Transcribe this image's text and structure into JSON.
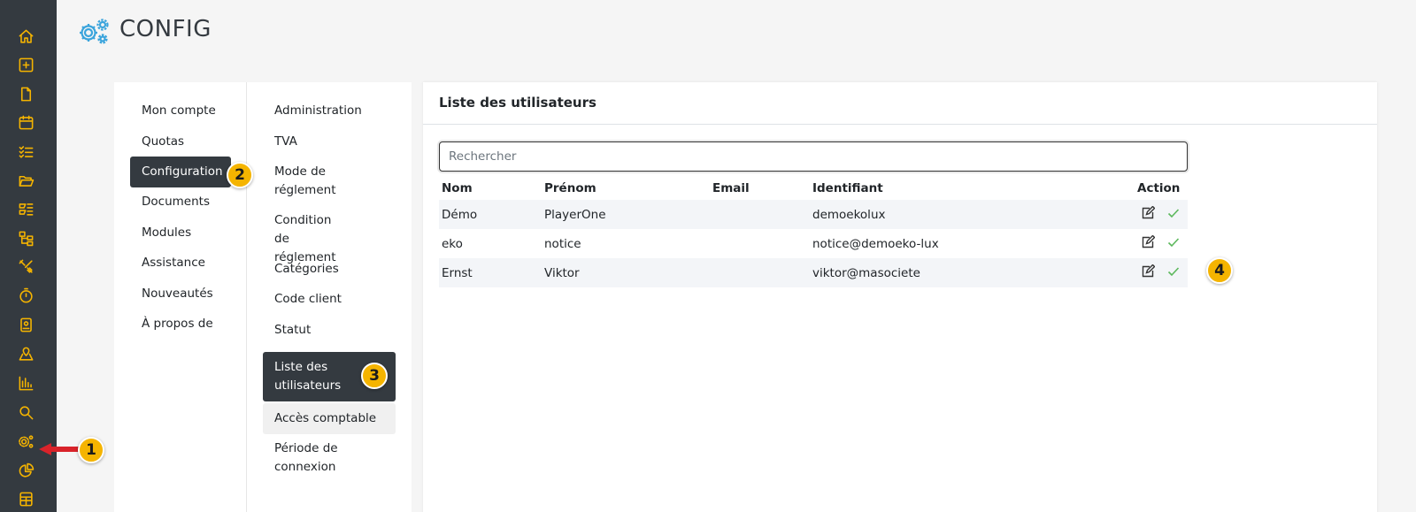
{
  "header": {
    "title": "CONFIG",
    "icon": "gears-icon",
    "icon_color": "#3aa4dc"
  },
  "rail": {
    "background": "#343a40",
    "icon_color": "#f5b400",
    "icons": [
      "home-icon",
      "plus-square-icon",
      "file-icon",
      "calendar-icon",
      "checklist-icon",
      "folder-open-icon",
      "tools-list-icon",
      "sitemap-icon",
      "wrench-screwdriver-icon",
      "stopwatch-icon",
      "contact-card-icon",
      "map-pin-icon",
      "bar-chart-icon",
      "search-icon",
      "gears-icon",
      "pie-chart-icon",
      "calculator-icon"
    ]
  },
  "menu": {
    "primary": [
      {
        "label": "Mon compte"
      },
      {
        "label": "Quotas"
      },
      {
        "label": "Configuration",
        "active": true
      },
      {
        "label": "Documents"
      },
      {
        "label": "Modules"
      },
      {
        "label": "Assistance"
      },
      {
        "label": "Nouveautés"
      },
      {
        "label": "À propos de"
      }
    ],
    "secondary": [
      {
        "label": "Administration"
      },
      {
        "label": "TVA"
      },
      {
        "label": "Mode de réglement"
      },
      {
        "label": "Condition de réglement"
      },
      {
        "label": "Catégories"
      },
      {
        "label": "Code client"
      },
      {
        "label": "Statut"
      },
      {
        "label": "Liste des utilisateurs",
        "active": true
      },
      {
        "label": "Accès comptable",
        "hover": true
      },
      {
        "label": "Période de connexion"
      }
    ]
  },
  "users": {
    "title": "Liste des utilisateurs",
    "search_placeholder": "Rechercher",
    "columns": [
      "Nom",
      "Prénom",
      "Email",
      "Identifiant",
      "Action"
    ],
    "rows": [
      {
        "nom": "Démo",
        "prenom": "PlayerOne",
        "email": "",
        "identifiant": "demoekolux"
      },
      {
        "nom": "eko",
        "prenom": "notice",
        "email": "",
        "identifiant": "notice@demoeko-lux"
      },
      {
        "nom": "Ernst",
        "prenom": "Viktor",
        "email": "",
        "identifiant": "viktor@masociete"
      }
    ],
    "actions": [
      "edit-icon",
      "check-icon"
    ],
    "check_color": "#5cb85c"
  },
  "badges": [
    "1",
    "2",
    "3",
    "4"
  ],
  "badge_color": "#f5b400",
  "arrow_color": "#d9232a"
}
